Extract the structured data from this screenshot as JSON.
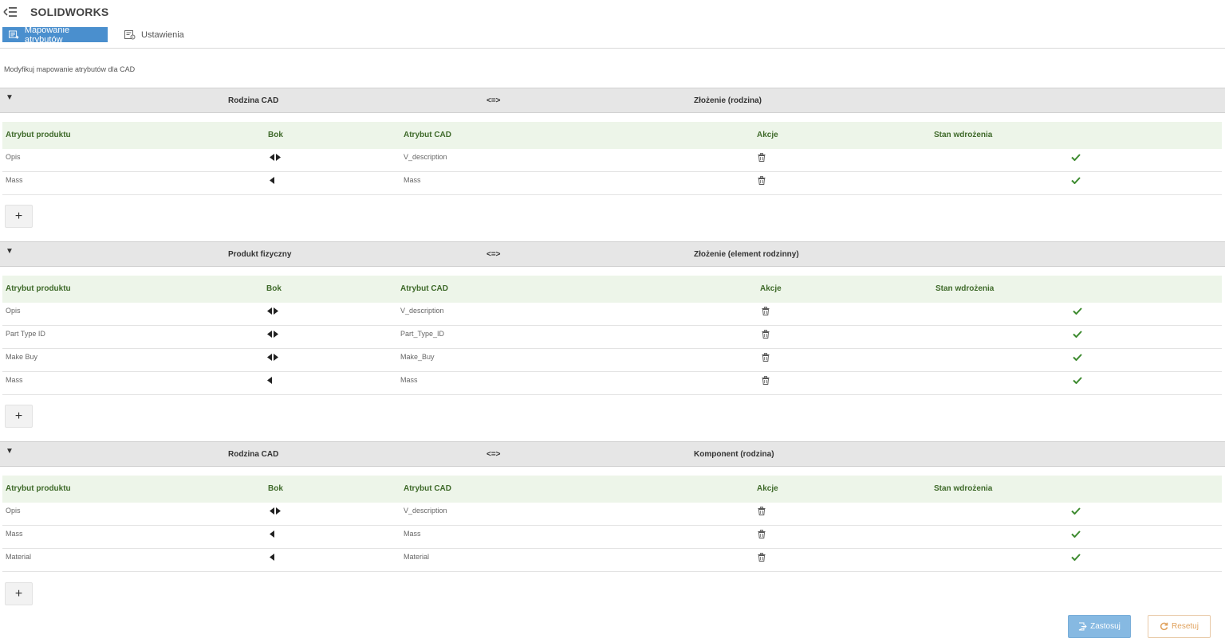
{
  "app": {
    "title": "SOLIDWORKS"
  },
  "tabs": [
    {
      "label": "Mapowanie atrybutów",
      "active": true,
      "icon": "mapping-icon"
    },
    {
      "label": "Ustawienia",
      "active": false,
      "icon": "settings-icon"
    }
  ],
  "subtitle": "Modyfikuj mapowanie atrybutów dla CAD",
  "columns": {
    "product_attr": "Atrybut produktu",
    "side": "Bok",
    "cad_attr": "Atrybut CAD",
    "actions": "Akcje",
    "status": "Stan wdrożenia"
  },
  "groups": [
    {
      "left": "Rodzina CAD",
      "arrow": "<=>",
      "right": "Złożenie (rodzina)",
      "rows": [
        {
          "product": "Opis",
          "direction": "both",
          "cad": "V_description",
          "status": "ok"
        },
        {
          "product": "Mass",
          "direction": "left",
          "cad": "Mass",
          "status": "ok"
        }
      ]
    },
    {
      "left": "Produkt fizyczny",
      "arrow": "<=>",
      "right": "Złożenie (element rodzinny)",
      "rows": [
        {
          "product": "Opis",
          "direction": "both",
          "cad": "V_description",
          "status": "ok"
        },
        {
          "product": "Part Type ID",
          "direction": "both",
          "cad": "Part_Type_ID",
          "status": "ok"
        },
        {
          "product": "Make Buy",
          "direction": "both",
          "cad": "Make_Buy",
          "status": "ok"
        },
        {
          "product": "Mass",
          "direction": "left",
          "cad": "Mass",
          "status": "ok"
        }
      ]
    },
    {
      "left": "Rodzina CAD",
      "arrow": "<=>",
      "right": "Komponent (rodzina)",
      "rows": [
        {
          "product": "Opis",
          "direction": "both",
          "cad": "V_description",
          "status": "ok"
        },
        {
          "product": "Mass",
          "direction": "left",
          "cad": "Mass",
          "status": "ok"
        },
        {
          "product": "Material",
          "direction": "left",
          "cad": "Material",
          "status": "ok"
        }
      ]
    }
  ],
  "buttons": {
    "apply": "Zastosuj",
    "reset": "Resetuj",
    "add": "+"
  },
  "colors": {
    "accent": "#4a8fce",
    "check": "#3c8a2e",
    "header_green": "#3f6a2a",
    "reset": "#e0a25e"
  }
}
